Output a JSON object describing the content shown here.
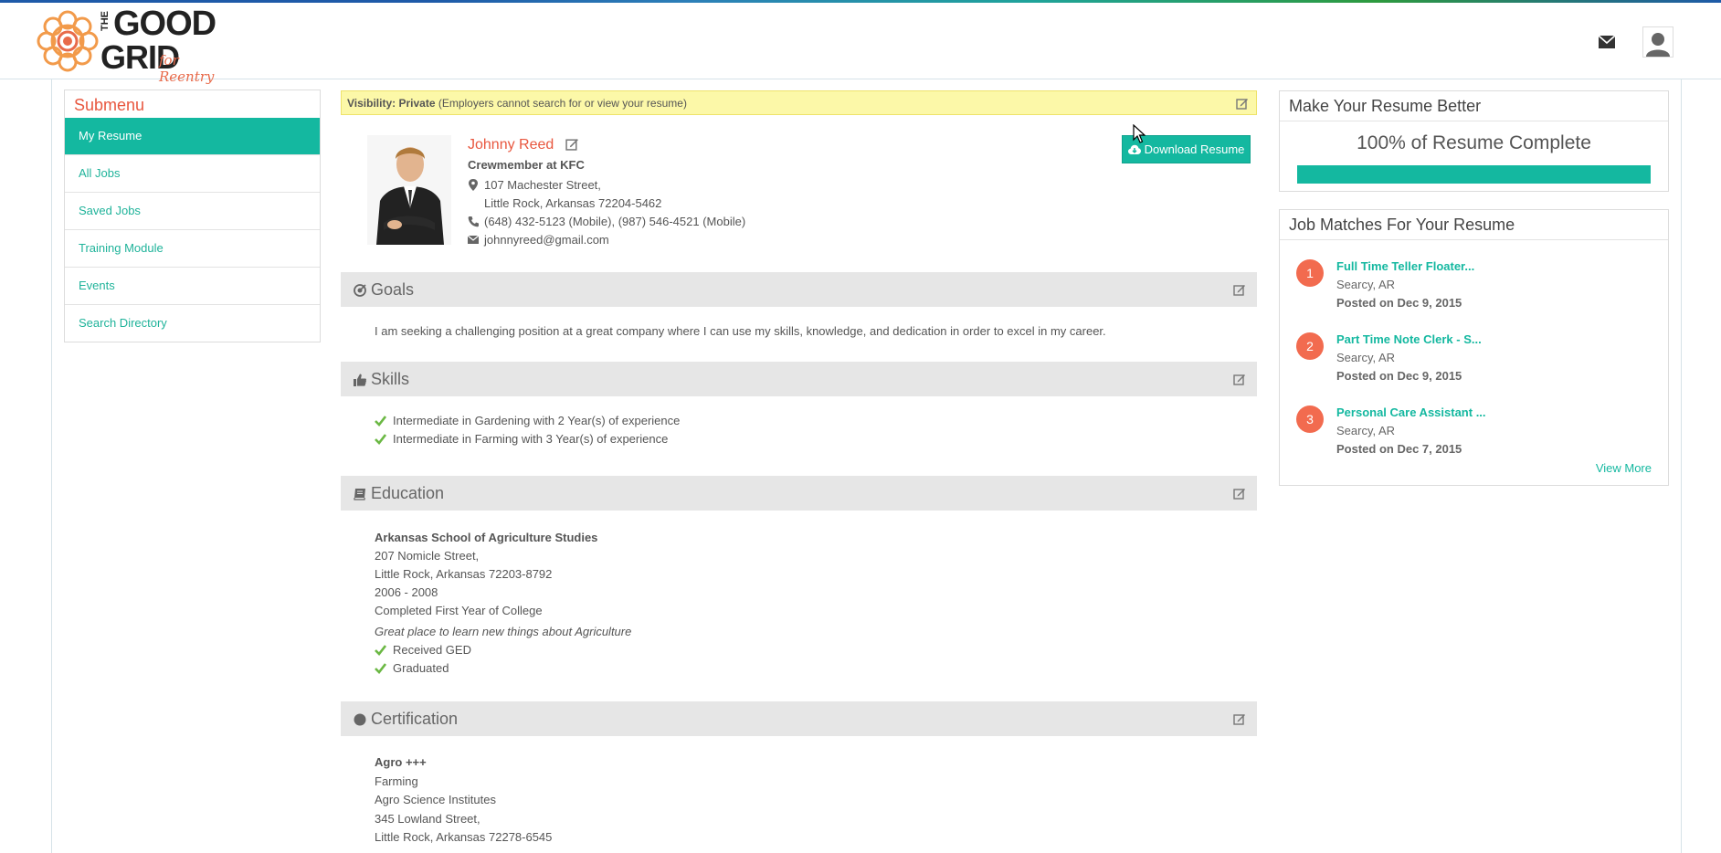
{
  "header": {
    "logo": {
      "the": "THE",
      "good": "GOOD",
      "grid": "GRID",
      "tagline": "for Reentry"
    },
    "mail_icon": "envelope-icon",
    "profile_icon": "user-silhouette-icon"
  },
  "submenu": {
    "title": "Submenu",
    "items": [
      {
        "label": "My Resume",
        "active": true
      },
      {
        "label": "All Jobs"
      },
      {
        "label": "Saved Jobs"
      },
      {
        "label": "Training Module"
      },
      {
        "label": "Events"
      },
      {
        "label": "Search Directory"
      }
    ]
  },
  "visibility": {
    "label": "Visibility: Private",
    "note": "(Employers cannot search for or view your resume)"
  },
  "profile": {
    "name": "Johnny Reed",
    "title": "Crewmember at KFC",
    "address_line1": "107 Machester Street,",
    "address_line2": "Little Rock, Arkansas  72204-5462",
    "phones": "(648) 432-5123 (Mobile), (987) 546-4521 (Mobile)",
    "email": "johnnyreed@gmail.com",
    "download_label": "Download Resume"
  },
  "goals": {
    "heading": "Goals",
    "text": "I am seeking a challenging position at a great company where I can use my skills, knowledge, and dedication in order to excel in my career."
  },
  "skills": {
    "heading": "Skills",
    "items": [
      "Intermediate in Gardening with 2  Year(s) of experience",
      "Intermediate in Farming with 3  Year(s) of experience"
    ]
  },
  "education": {
    "heading": "Education",
    "school": "Arkansas School of Agriculture Studies",
    "street": "207 Nomicle Street,",
    "city": "Little Rock, Arkansas  72203-8792",
    "years": "2006 - 2008",
    "level": "Completed First Year of College",
    "comment": "Great place to learn new things about Agriculture",
    "checks": [
      "Received GED",
      "Graduated"
    ]
  },
  "certification": {
    "heading": "Certification",
    "name": "Agro +++",
    "field": "Farming",
    "institute": "Agro Science Institutes",
    "street": "345 Lowland Street,",
    "city": "Little Rock, Arkansas  72278-6545"
  },
  "resume_better": {
    "title": "Make Your Resume Better",
    "complete_text": "100% of Resume Complete",
    "progress": 1.0
  },
  "job_matches": {
    "title": "Job Matches For Your Resume",
    "jobs": [
      {
        "num": "1",
        "title": "Full Time Teller Floater...",
        "location": "Searcy, AR",
        "posted": "Posted on Dec 9, 2015"
      },
      {
        "num": "2",
        "title": "Part Time Note Clerk - S...",
        "location": "Searcy, AR",
        "posted": "Posted on Dec 9, 2015"
      },
      {
        "num": "3",
        "title": "Personal Care Assistant ...",
        "location": "Searcy, AR",
        "posted": "Posted on Dec 7, 2015"
      }
    ],
    "view_more": "View More"
  },
  "colors": {
    "accent": "#14b8a0",
    "brand_orange": "#e8573f",
    "visibility_bg": "#fcf8a8",
    "badge": "#f26b4f"
  }
}
